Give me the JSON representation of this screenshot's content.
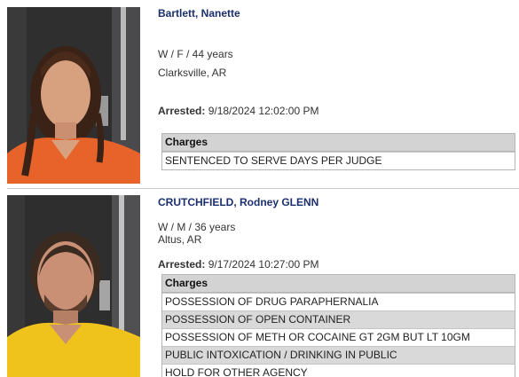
{
  "records": [
    {
      "name": "Bartlett, Nanette",
      "demographics": "W / F / 44 years",
      "location": "Clarksville, AR",
      "arrested_label": "Arrested:",
      "arrested_value": "9/18/2024 12:02:00 PM",
      "charges_header": "Charges",
      "charges": [
        "SENTENCED TO SERVE DAYS PER JUDGE"
      ]
    },
    {
      "name": "CRUTCHFIELD, Rodney GLENN",
      "demographics": "W / M / 36 years",
      "location": "Altus, AR",
      "arrested_label": "Arrested:",
      "arrested_value": "9/17/2024 10:27:00 PM",
      "charges_header": "Charges",
      "charges": [
        "POSSESSION OF DRUG PARAPHERNALIA",
        "POSSESSION OF OPEN CONTAINER",
        "POSSESSION OF METH OR COCAINE GT 2GM BUT LT 10GM",
        "PUBLIC INTOXICATION / DRINKING IN PUBLIC",
        "HOLD FOR OTHER AGENCY"
      ]
    }
  ],
  "colors": {
    "name_link": "#1b2f6e",
    "charges_header_bg": "#d3d3d3",
    "charges_alt_row_bg": "#d9d9d9",
    "uniform_orange": "#e8632a",
    "uniform_yellow": "#f0c21c"
  }
}
